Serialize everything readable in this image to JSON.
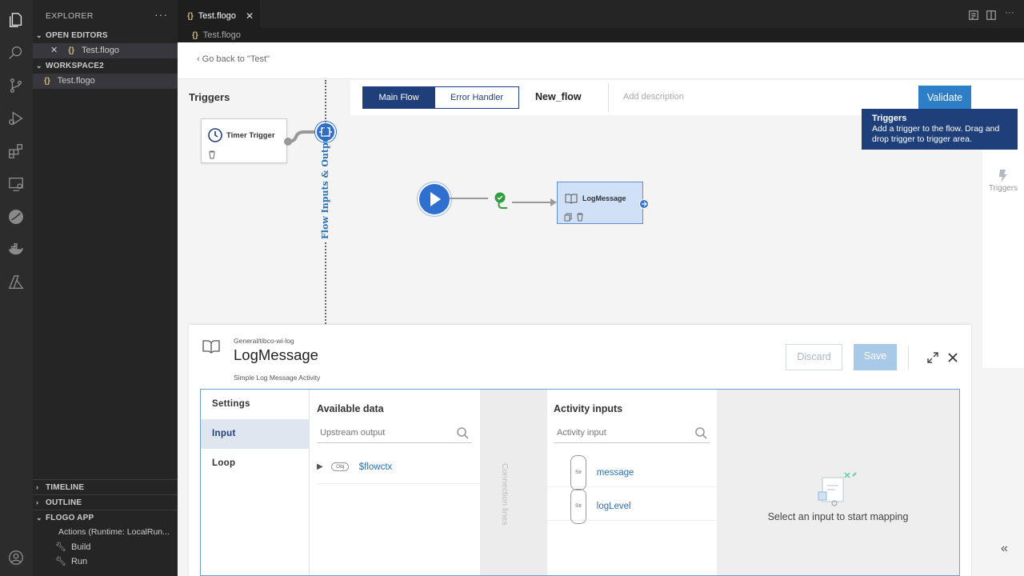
{
  "explorer": {
    "title": "EXPLORER",
    "more": "···",
    "open_editors_header": "OPEN EDITORS",
    "open_editors": [
      {
        "icon": "{}",
        "name": "Test.flogo"
      }
    ],
    "workspace_header": "WORKSPACE2",
    "workspace_files": [
      {
        "icon": "{}",
        "name": "Test.flogo"
      }
    ],
    "timeline_header": "TIMELINE",
    "outline_header": "OUTLINE",
    "flogo_app_header": "FLOGO APP",
    "flogo_app_items": [
      "Actions (Runtime: LocalRun...",
      "Build",
      "Run"
    ]
  },
  "editor": {
    "tab_label": "Test.flogo",
    "tab_icon": "{}",
    "tab_close": "✕",
    "breadcrumb_icon": "{}",
    "breadcrumb": "Test.flogo"
  },
  "flogo": {
    "back_link": "Go back to \"Test\"",
    "triggers_title": "Triggers",
    "timer_trigger": "Timer Trigger",
    "flow_io_label": "Flow Inputs & Outputs",
    "tabs": {
      "main": "Main Flow",
      "error": "Error Handler"
    },
    "flow_name": "New_flow",
    "add_description": "Add description",
    "validate": "Validate",
    "tooltip": {
      "title": "Triggers",
      "body": "Add a trigger to the flow. Drag and drop trigger to trigger area."
    },
    "rail_triggers_label": "Triggers",
    "activity_node_label": "LogMessage"
  },
  "detail": {
    "path": "General/tibco-wi-log",
    "name": "LogMessage",
    "description": "Simple Log Message Activity",
    "discard": "Discard",
    "save": "Save",
    "tabs": [
      "Settings",
      "Input",
      "Loop"
    ],
    "active_tab": "Input",
    "available_data_title": "Available data",
    "upstream_placeholder": "Upstream output",
    "upstream_items": [
      {
        "type": "Obj",
        "name": "$flowctx"
      }
    ],
    "connection_lines": "Connection lines",
    "activity_inputs_title": "Activity inputs",
    "activity_input_placeholder": "Activity input",
    "inputs": [
      {
        "type": "Str",
        "name": "message"
      },
      {
        "type": "Str",
        "name": "logLevel"
      }
    ],
    "empty_mapping": "Select an input to start mapping"
  },
  "colors": {
    "accent": "#1f3f7a",
    "validate": "#2d7ec7",
    "save_disabled": "#a9c9e8",
    "play": "#2f6fd0",
    "success": "#2e9e3e"
  }
}
